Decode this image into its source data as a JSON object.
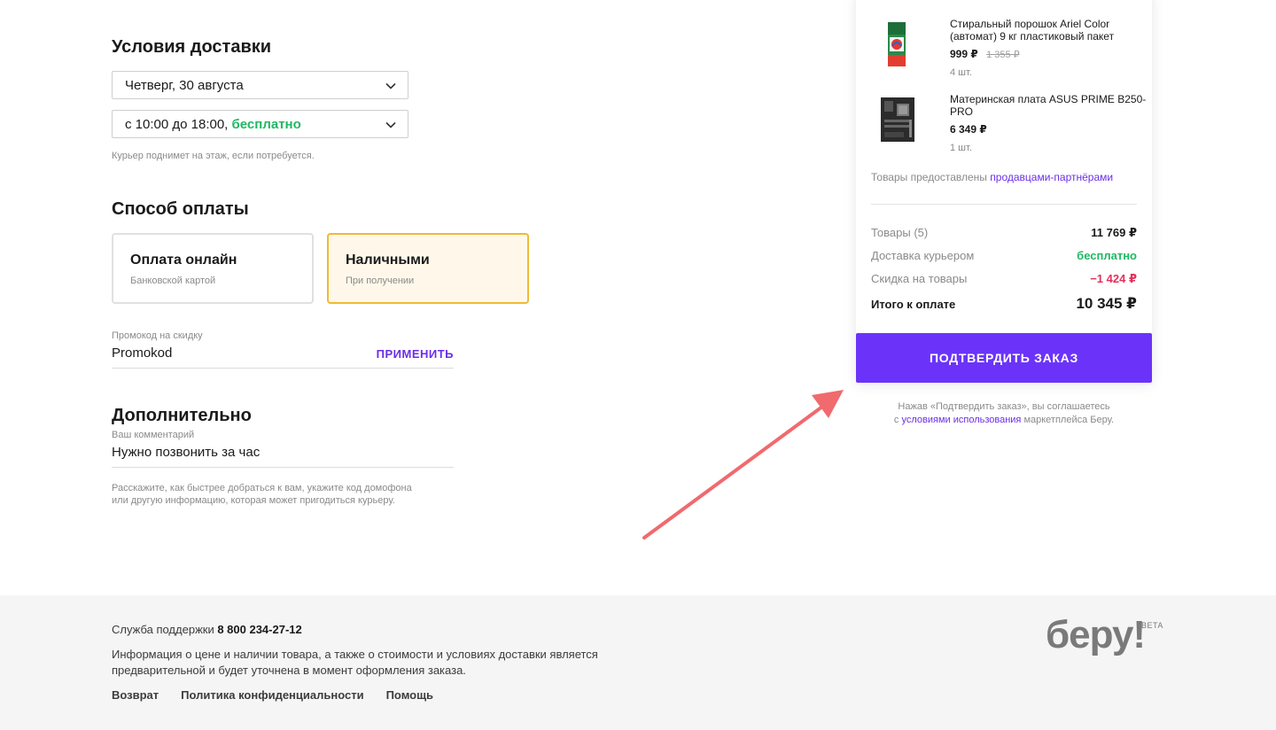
{
  "delivery": {
    "title": "Условия доставки",
    "date": "Четверг, 30 августа",
    "time_prefix": "с 10:00 до 18:00, ",
    "time_free": "бесплатно",
    "hint": "Курьер поднимет на этаж, если потребуется."
  },
  "payment": {
    "title": "Способ оплаты",
    "online_title": "Оплата онлайн",
    "online_sub": "Банковской картой",
    "cash_title": "Наличными",
    "cash_sub": "При получении"
  },
  "promo": {
    "label": "Промокод на скидку",
    "value": "Promokod",
    "apply": "ПРИМЕНИТЬ"
  },
  "extra": {
    "title": "Дополнительно",
    "label": "Ваш комментарий",
    "value": "Нужно позвонить за час",
    "hint_line1": "Расскажите, как быстрее добраться к вам, укажите код домофона",
    "hint_line2": "или другую информацию, которая может пригодиться курьеру."
  },
  "order": {
    "items": [
      {
        "name": "Стиральный порошок Ariel Color (автомат) 9 кг пластиковый пакет",
        "price": "999 ₽",
        "old_price": "1 355 ₽",
        "qty": "4 шт."
      },
      {
        "name": "Материнская плата ASUS PRIME B250-PRO",
        "price": "6 349 ₽",
        "old_price": "",
        "qty": "1 шт."
      }
    ],
    "partners_prefix": "Товары предоставлены ",
    "partners_link": "продавцами-партнёрами",
    "summary": {
      "goods_label": "Товары (5)",
      "goods_value": "11 769 ₽",
      "delivery_label": "Доставка курьером",
      "delivery_value": "бесплатно",
      "discount_label": "Скидка на товары",
      "discount_value": "−1 424 ₽",
      "total_label": "Итого к оплате",
      "total_value": "10 345 ₽"
    },
    "confirm": "ПОДТВЕРДИТЬ ЗАКАЗ",
    "agree_prefix": "Нажав «Подтвердить заказ», вы соглашаетесь",
    "agree_pre_link": "с ",
    "agree_link": "условиями использования",
    "agree_suffix": " маркетплейса Беру."
  },
  "footer": {
    "support_label": "Служба поддержки ",
    "support_phone": "8 800 234-27-12",
    "info_line1": "Информация о цене и наличии товара, а также о стоимости и условиях доставки является",
    "info_line2": "предварительной и будет уточнена в момент оформления заказа.",
    "links": [
      "Возврат",
      "Политика конфиденциальности",
      "Помощь"
    ],
    "logo": "беру!",
    "beta": "BETA"
  },
  "colors": {
    "accent": "#6b33fa",
    "free": "#1fb863",
    "discount": "#e2305c",
    "selected_border": "#f0ba33",
    "arrow": "#f06a6e"
  }
}
